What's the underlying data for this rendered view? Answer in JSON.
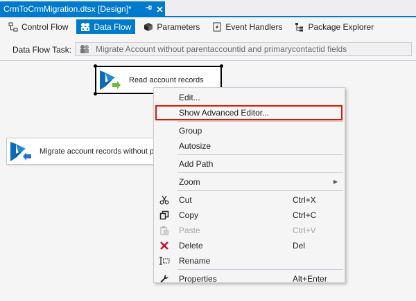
{
  "document_tab": {
    "title": "CrmToCrmMigration.dtsx [Design]*",
    "pin_icon": "pin-icon",
    "close_icon": "close-icon"
  },
  "designer_tabs": [
    {
      "label": "Control Flow",
      "icon": "control-flow-icon",
      "active": false
    },
    {
      "label": "Data Flow",
      "icon": "data-flow-icon",
      "active": true
    },
    {
      "label": "Parameters",
      "icon": "parameters-icon",
      "active": false
    },
    {
      "label": "Event Handlers",
      "icon": "event-handlers-icon",
      "active": false
    },
    {
      "label": "Package Explorer",
      "icon": "package-explorer-icon",
      "active": false
    }
  ],
  "task": {
    "label": "Data Flow Task:",
    "value": "Migrate Account without parentaccountid and primarycontactid fields"
  },
  "components": {
    "read": "Read account records",
    "migrate": "Migrate account records without pa"
  },
  "menu": {
    "items": [
      {
        "label": "Edit...",
        "shortcut": "",
        "icon": ""
      },
      {
        "label": "Show Advanced Editor...",
        "shortcut": "",
        "icon": ""
      },
      {
        "label": "Group",
        "shortcut": "",
        "icon": ""
      },
      {
        "label": "Autosize",
        "shortcut": "",
        "icon": ""
      },
      {
        "label": "Add Path",
        "shortcut": "",
        "icon": ""
      },
      {
        "label": "Zoom",
        "shortcut": "",
        "icon": ""
      },
      {
        "label": "Cut",
        "shortcut": "Ctrl+X",
        "icon": "scissors-icon"
      },
      {
        "label": "Copy",
        "shortcut": "Ctrl+C",
        "icon": "copy-icon"
      },
      {
        "label": "Paste",
        "shortcut": "Ctrl+V",
        "icon": "paste-icon"
      },
      {
        "label": "Delete",
        "shortcut": "Del",
        "icon": "delete-icon"
      },
      {
        "label": "Rename",
        "shortcut": "",
        "icon": "rename-icon"
      },
      {
        "label": "Properties",
        "shortcut": "Alt+Enter",
        "icon": "wrench-icon"
      }
    ]
  },
  "colors": {
    "accent": "#007acc",
    "highlight_border": "#e51400",
    "delete_red": "#c8102e"
  }
}
